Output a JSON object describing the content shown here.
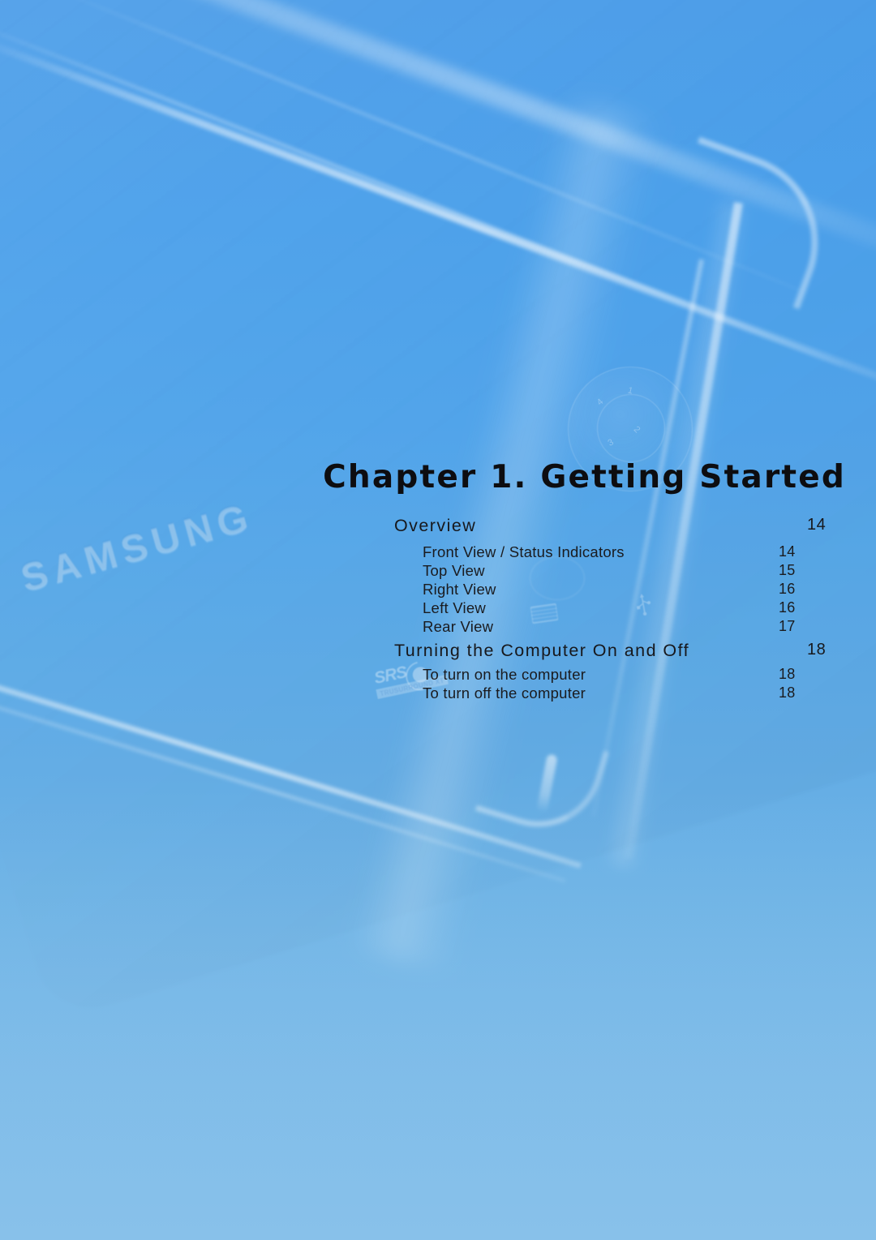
{
  "page": {
    "chapter_title": "Chapter 1. Getting Started",
    "background": {
      "base_color": "#4a9ce8",
      "bottom_color": "#80bde9",
      "text_color": "#0d0d10"
    },
    "watermarks": {
      "brand": "SAMSUNG",
      "audio_logo": "SRS",
      "audio_logo_sub": "TRUSURROUND XT"
    },
    "dial_labels": [
      "1",
      "2",
      "3",
      "4"
    ]
  },
  "toc": {
    "entries": [
      {
        "label": "Overview",
        "page": "14",
        "level": "section"
      },
      {
        "label": "Front View / Status Indicators",
        "page": "14",
        "level": "sub"
      },
      {
        "label": "Top View",
        "page": "15",
        "level": "sub"
      },
      {
        "label": "Right View",
        "page": "16",
        "level": "sub"
      },
      {
        "label": "Left View",
        "page": "16",
        "level": "sub"
      },
      {
        "label": "Rear View",
        "page": "17",
        "level": "sub"
      },
      {
        "label": "Turning the Computer On and Off",
        "page": "18",
        "level": "section"
      },
      {
        "label": "To turn on the computer",
        "page": "18",
        "level": "sub"
      },
      {
        "label": "To turn off the computer",
        "page": "18",
        "level": "sub"
      }
    ]
  }
}
